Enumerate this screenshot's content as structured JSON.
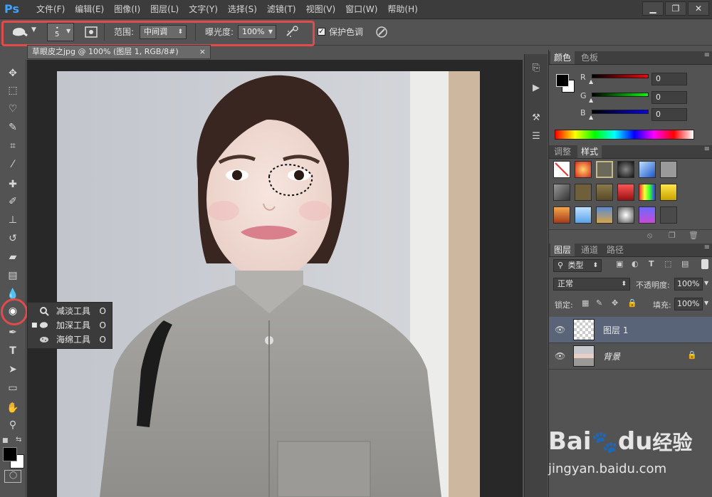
{
  "app": {
    "logo": "Ps"
  },
  "menu": [
    "文件(F)",
    "编辑(E)",
    "图像(I)",
    "图层(L)",
    "文字(Y)",
    "选择(S)",
    "滤镜(T)",
    "视图(V)",
    "窗口(W)",
    "帮助(H)"
  ],
  "window_controls": {
    "minimize": "▁",
    "restore": "❐",
    "close": "✕"
  },
  "options": {
    "brush_size": "5",
    "range_label": "范围:",
    "range_value": "中间调",
    "exposure_label": "曝光度:",
    "exposure_value": "100%",
    "protect_label": "保护色调",
    "protect_checked": "✓"
  },
  "document": {
    "tab_title": "草眼皮之jpg @ 100% (图层 1, RGB/8#)",
    "tab_close": "×"
  },
  "flyout": [
    {
      "label": "减淡工具",
      "key": "O"
    },
    {
      "label": "加深工具",
      "key": "O"
    },
    {
      "label": "海绵工具",
      "key": "O"
    }
  ],
  "color_panel": {
    "tabs": [
      "颜色",
      "色板"
    ],
    "channels": [
      {
        "name": "R",
        "value": "0"
      },
      {
        "name": "G",
        "value": "0"
      },
      {
        "name": "B",
        "value": "0"
      }
    ]
  },
  "styles_panel": {
    "tabs": [
      "调整",
      "样式"
    ]
  },
  "layers_panel": {
    "tabs": [
      "图层",
      "通道",
      "路径"
    ],
    "filter_label": "类型",
    "blend_mode": "正常",
    "opacity_label": "不透明度:",
    "opacity_value": "100%",
    "lock_label": "锁定:",
    "fill_label": "填充:",
    "fill_value": "100%",
    "layers": [
      {
        "name": "图层 1"
      },
      {
        "name": "背景"
      }
    ]
  },
  "watermark": {
    "brand": "Bai",
    "brand2": "du",
    "cn": "经验",
    "url": "jingyan.baidu.com"
  },
  "colors": {
    "accent_red": "#e24b4b",
    "ps_blue": "#3fa2ff",
    "selected_layer": "#5a6478"
  }
}
